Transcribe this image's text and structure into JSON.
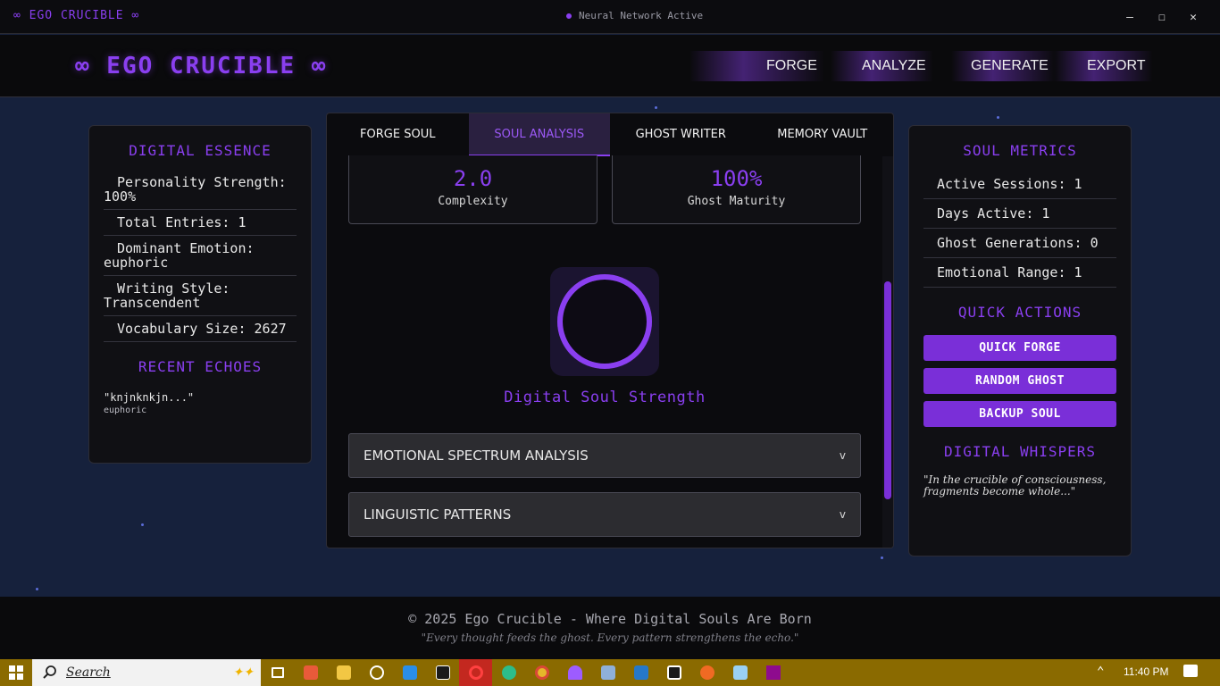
{
  "titlebar": {
    "app_title": "∞ EGO CRUCIBLE ∞",
    "status": "Neural Network Active",
    "minimize": "–",
    "maximize": "☐",
    "close": "✕"
  },
  "nav": {
    "logo": "∞ EGO CRUCIBLE ∞",
    "items": [
      "FORGE",
      "ANALYZE",
      "GENERATE",
      "EXPORT"
    ]
  },
  "left_panel": {
    "title": "DIGITAL ESSENCE",
    "stats": [
      "Personality Strength: 100%",
      "Total Entries: 1",
      "Dominant Emotion: euphoric",
      "Writing Style: Transcendent",
      "Vocabulary Size: 2627"
    ],
    "recent_title": "RECENT ECHOES",
    "echoes": [
      {
        "text": "\"knjnknkjn...\"",
        "emotion": "euphoric"
      }
    ]
  },
  "main_panel": {
    "tabs": [
      "FORGE SOUL",
      "SOUL ANALYSIS",
      "GHOST WRITER",
      "MEMORY VAULT"
    ],
    "active_tab": "SOUL ANALYSIS",
    "metrics": [
      {
        "value": "2.0",
        "label": "Complexity"
      },
      {
        "value": "100%",
        "label": "Ghost Maturity"
      }
    ],
    "soul_strength": 1.0,
    "strength_label": "Digital Soul Strength",
    "accordions": [
      {
        "label": "EMOTIONAL SPECTRUM ANALYSIS",
        "chevron": "v"
      },
      {
        "label": "LINGUISTIC PATTERNS",
        "chevron": "v"
      }
    ]
  },
  "right_panel": {
    "title": "SOUL METRICS",
    "stats": [
      "Active Sessions: 1",
      "Days Active: 1",
      "Ghost Generations: 0",
      "Emotional Range: 1"
    ],
    "quick_title": "QUICK ACTIONS",
    "buttons": [
      "QUICK FORGE",
      "RANDOM GHOST",
      "BACKUP SOUL"
    ],
    "whisper_title": "DIGITAL WHISPERS",
    "whisper": "\"In the crucible of consciousness, fragments become whole...\""
  },
  "footer": {
    "copy": "© 2025 Ego Crucible - Where Digital Souls Are Born",
    "quote": "\"Every thought feeds the ghost. Every pattern strengthens the echo.\""
  },
  "taskbar": {
    "search_placeholder": "Search",
    "time": "11:40 PM",
    "icons": [
      "task-view-icon",
      "app-red-icon",
      "file-explorer-icon",
      "chatgpt-icon",
      "vscode-icon",
      "ai-app-icon",
      "opera-icon",
      "edge-icon",
      "chrome-icon",
      "app-purple-icon",
      "app-icon",
      "app-blue-icon",
      "app-dark-icon",
      "firefox-icon",
      "notepad-icon",
      "app-magenta-icon"
    ]
  },
  "colors": {
    "accent": "#8a3ff0",
    "button": "#7a2fd8",
    "background": "#16213c",
    "taskbar": "#8a6a00"
  }
}
